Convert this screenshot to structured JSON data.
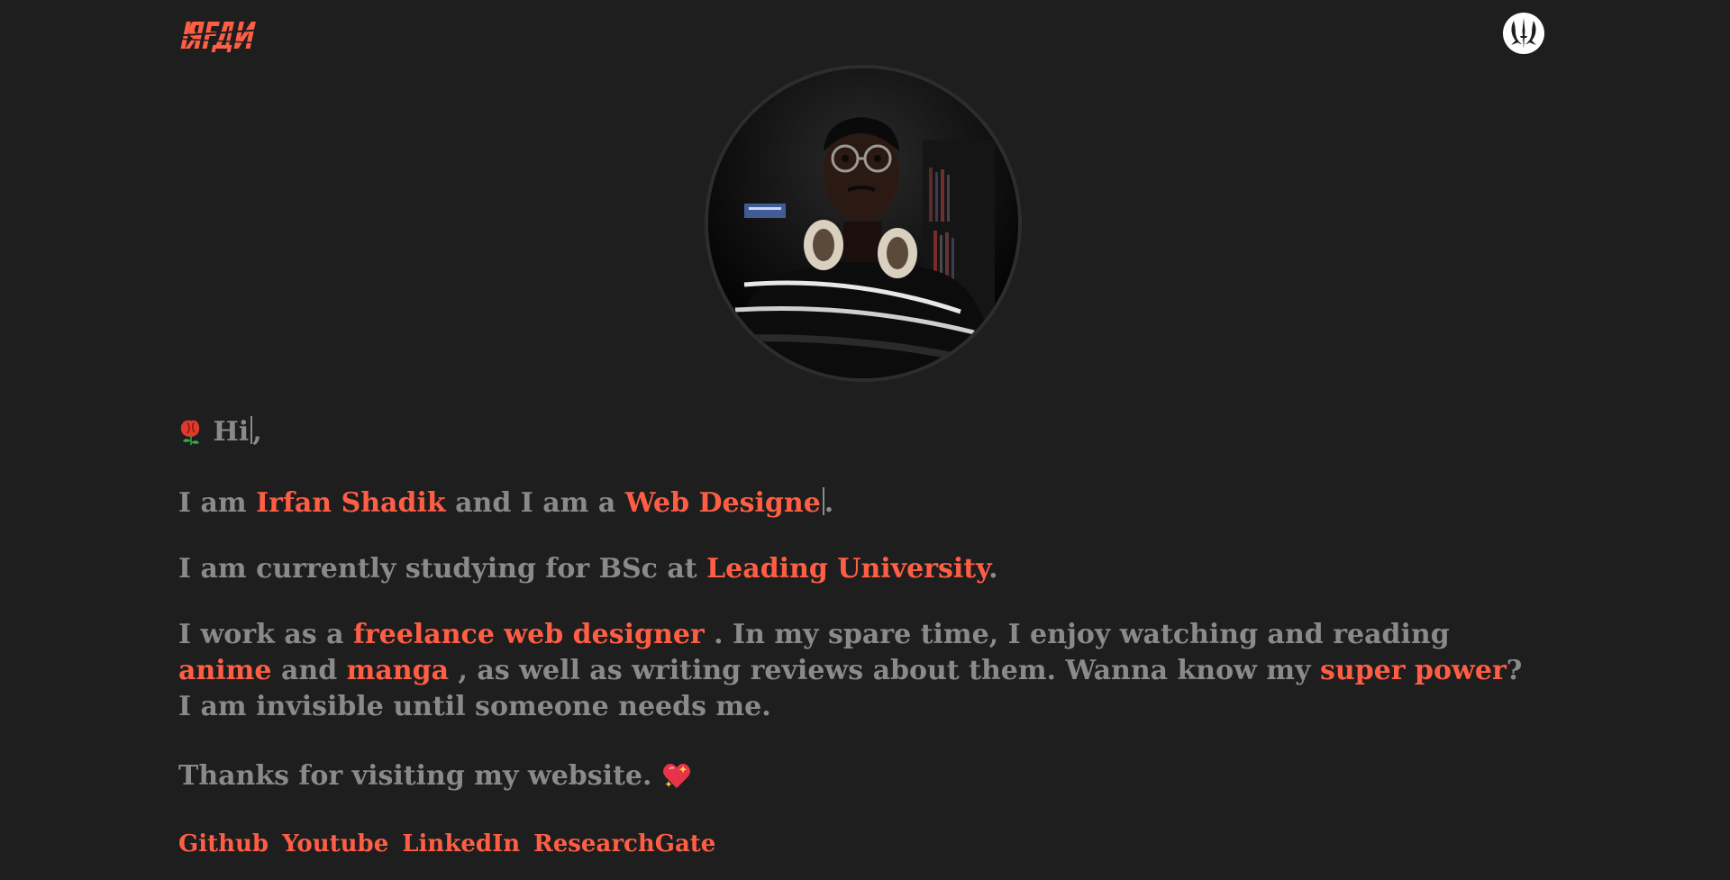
{
  "header": {
    "logo_text": "IЯFДИ",
    "theme_icon": "jedi-order-icon"
  },
  "profile": {
    "avatar": "profile-photo"
  },
  "intro": {
    "greeting": "Hi",
    "greeting_suffix": ",",
    "i_am": "I am",
    "name": "Irfan Shadik",
    "and_i_am_a": "and I am a",
    "role_typed": "Web Designe",
    "role_suffix": "."
  },
  "study": {
    "prefix": "I am currently studying for BSc at",
    "university": "Leading University",
    "suffix": "."
  },
  "work": {
    "prefix": "I work as a",
    "job": "freelance web designer",
    "middle": ". In my spare time, I enjoy watching and reading",
    "anime": "anime",
    "and": "and",
    "manga": "manga",
    "middle2": ", as well as writing reviews about them. Wanna know my",
    "power": "super power",
    "suffix": "? I am invisible until someone needs me."
  },
  "thanks": {
    "text": "Thanks for visiting my website."
  },
  "links": [
    {
      "label": "Github"
    },
    {
      "label": "Youtube"
    },
    {
      "label": "LinkedIn"
    },
    {
      "label": "ResearchGate"
    }
  ],
  "colors": {
    "background": "#1e1e1e",
    "accent": "#ff5e45",
    "text": "#8a8a8a"
  }
}
